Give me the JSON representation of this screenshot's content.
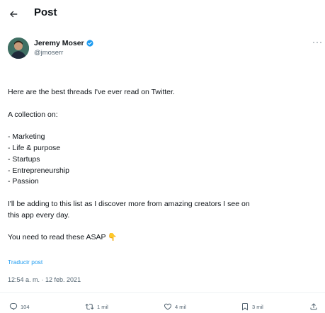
{
  "header": {
    "back_icon": "arrow-left-icon",
    "title": "Post"
  },
  "author": {
    "name": "Jeremy Moser",
    "handle": "@jmoserr",
    "verified_color": "#1d9bf0"
  },
  "tweet": {
    "lines": [
      "Here are the best threads I've ever read on Twitter.",
      "",
      "A collection on:",
      "",
      "- Marketing",
      "- Life & purpose",
      "- Startups",
      "- Entrepreneurship",
      "- Passion",
      "",
      "I'll be adding to this list as I discover more from amazing creators I see on",
      "this app every day.",
      "",
      "You need to read these ASAP 👇"
    ],
    "translate_label": "Traducir post",
    "timestamp": "12:54 a. m. · 12 feb. 2021"
  },
  "actions": {
    "reply_count": "104",
    "retweet_count": "1 mil",
    "like_count": "4 mil",
    "bookmark_count": "3 mil"
  },
  "colors": {
    "accent": "#1d9bf0",
    "text_primary": "#0f1419",
    "text_secondary": "#536471",
    "emoji": "#f5c33b"
  }
}
